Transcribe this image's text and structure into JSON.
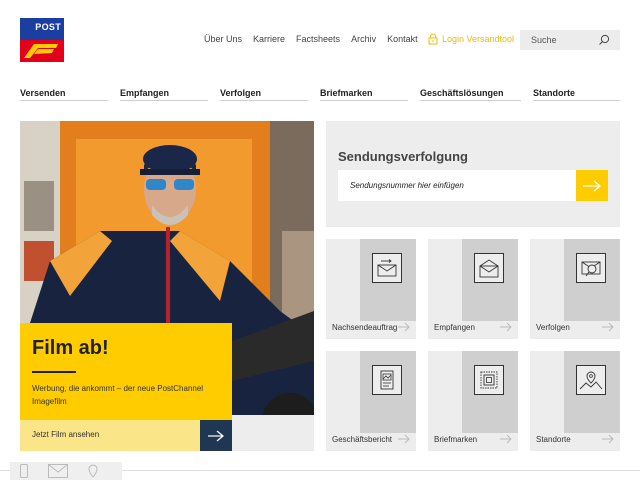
{
  "logo": {
    "text": "POST"
  },
  "top_nav": [
    "Über Uns",
    "Karriere",
    "Factsheets",
    "Archiv",
    "Kontakt"
  ],
  "login": {
    "label": "Login Versandtool"
  },
  "search": {
    "placeholder": "Suche"
  },
  "main_nav": [
    "Versenden",
    "Empfangen",
    "Verfolgen",
    "Briefmarken",
    "Geschäftslösungen",
    "Standorte"
  ],
  "hero": {
    "title": "Film ab!",
    "description": "Werbung, die ankommt – der neue PostChannel Imagefilm",
    "cta_label": "Jetzt Film ansehen"
  },
  "tracking": {
    "title": "Sendungsverfolgung",
    "placeholder": "Sendungsnummer hier einfügen"
  },
  "tiles": [
    {
      "label": "Nachsendeauftrag",
      "icon": "forwarding-mail-icon"
    },
    {
      "label": "Empfangen",
      "icon": "open-envelope-icon"
    },
    {
      "label": "Verfolgen",
      "icon": "track-search-icon"
    },
    {
      "label": "Geschäftsbericht",
      "icon": "report-document-icon"
    },
    {
      "label": "Briefmarken",
      "icon": "stamp-icon"
    },
    {
      "label": "Standorte",
      "icon": "map-pin-icon"
    }
  ],
  "colors": {
    "brand_yellow": "#ffcc00",
    "brand_blue": "#1b3fa0",
    "brand_red": "#e3001b",
    "dark_navy": "#1f3752"
  }
}
